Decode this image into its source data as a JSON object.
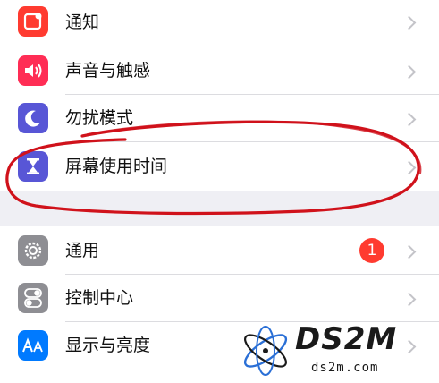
{
  "settings": {
    "group1": [
      {
        "label": "通知",
        "icon": "notifications-icon",
        "color": "#ff3b30"
      },
      {
        "label": "声音与触感",
        "icon": "sound-icon",
        "color": "#ff2d55"
      },
      {
        "label": "勿扰模式",
        "icon": "moon-icon",
        "color": "#5856d6"
      },
      {
        "label": "屏幕使用时间",
        "icon": "hourglass-icon",
        "color": "#5856d6"
      }
    ],
    "group2": [
      {
        "label": "通用",
        "icon": "gear-icon",
        "color": "#8e8e93",
        "badge": "1"
      },
      {
        "label": "控制中心",
        "icon": "toggles-icon",
        "color": "#8e8e93"
      },
      {
        "label": "显示与亮度",
        "icon": "text-size-icon",
        "color": "#007aff"
      }
    ]
  },
  "annotation": {
    "color": "#d0121b"
  },
  "watermark": {
    "title": "DS2M",
    "subtitle": "ds2m.com"
  }
}
